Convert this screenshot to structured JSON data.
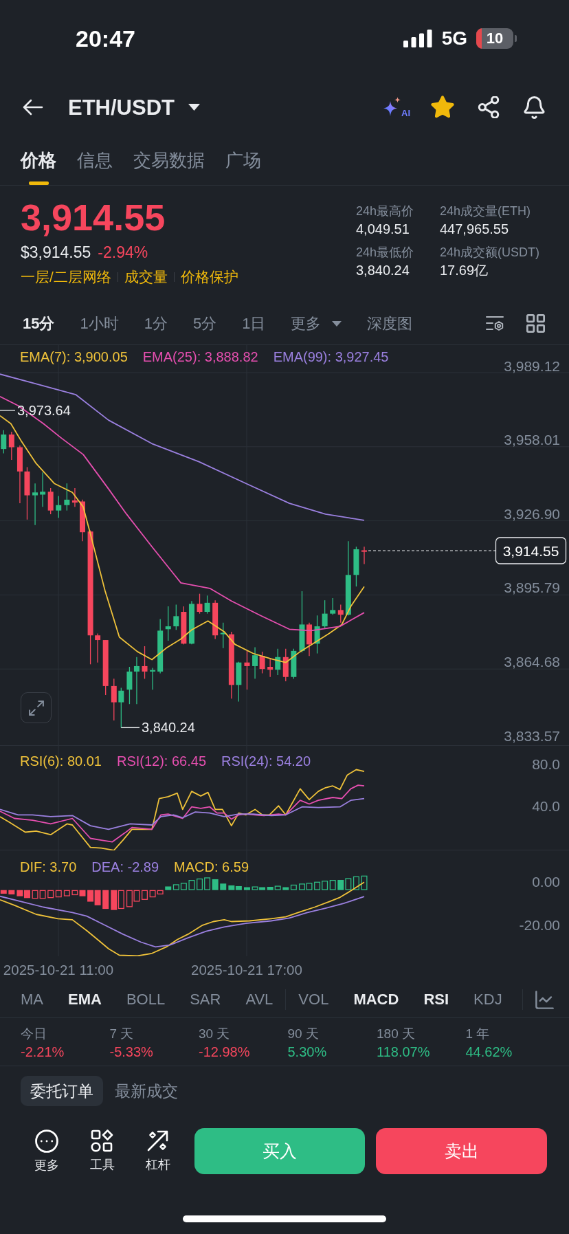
{
  "status_bar": {
    "time": "20:47",
    "network": "5G",
    "battery": "10"
  },
  "header": {
    "pair": "ETH/USDT",
    "ai_label": "AI",
    "favorite": true
  },
  "tabs": [
    {
      "label": "价格",
      "selected": true
    },
    {
      "label": "信息",
      "selected": false
    },
    {
      "label": "交易数据",
      "selected": false
    },
    {
      "label": "广场",
      "selected": false
    }
  ],
  "ticker": {
    "price": "3,914.55",
    "rising": false,
    "usd_price": "$3,914.55",
    "change": "-2.94%",
    "tags": [
      "一层/二层网络",
      "成交量",
      "价格保护"
    ],
    "stats": [
      {
        "label": "24h最高价",
        "value": "4,049.51"
      },
      {
        "label": "24h成交量(ETH)",
        "value": "447,965.55"
      },
      {
        "label": "24h最低价",
        "value": "3,840.24"
      },
      {
        "label": "24h成交额(USDT)",
        "value": "17.69亿"
      }
    ]
  },
  "intervals": [
    {
      "label": "15分",
      "selected": true,
      "kind": "option"
    },
    {
      "label": "1小时",
      "selected": false,
      "kind": "option"
    },
    {
      "label": "1分",
      "selected": false,
      "kind": "option"
    },
    {
      "label": "5分",
      "selected": false,
      "kind": "option"
    },
    {
      "label": "1日",
      "selected": false,
      "kind": "option"
    },
    {
      "label": "更多",
      "selected": false,
      "kind": "dropdown"
    },
    {
      "label": "深度图",
      "selected": false,
      "kind": "option"
    }
  ],
  "main_chart": {
    "legend": [
      {
        "label": "EMA(7): 3,900.05",
        "color": "#efc23a"
      },
      {
        "label": "EMA(25): 3,888.82",
        "color": "#e64fb0"
      },
      {
        "label": "EMA(99): 3,927.45",
        "color": "#9b80e0"
      }
    ],
    "y_labels": [
      "3,989.12",
      "3,958.01",
      "3,926.90",
      "3,895.79",
      "3,864.68",
      "3,833.57"
    ],
    "last_price": "3,914.55",
    "high_marker": "3,973.64",
    "low_marker": "3,840.24"
  },
  "rsi_chart": {
    "legend": [
      {
        "label": "RSI(6): 80.01",
        "color": "#efc23a"
      },
      {
        "label": "RSI(12): 66.45",
        "color": "#e64fb0"
      },
      {
        "label": "RSI(24): 54.20",
        "color": "#9b80e0"
      }
    ],
    "y_labels": [
      "80.0",
      "40.0"
    ]
  },
  "macd_chart": {
    "legend": [
      {
        "label": "DIF: 3.70",
        "color": "#efc23a"
      },
      {
        "label": "DEA: -2.89",
        "color": "#9b80e0"
      },
      {
        "label": "MACD: 6.59",
        "color": "#efc23a"
      }
    ],
    "y_labels": [
      "0.00",
      "-20.00"
    ]
  },
  "time_labels": [
    "2025-10-21 11:00",
    "2025-10-21 17:00"
  ],
  "indicators": {
    "main": [
      {
        "label": "MA",
        "selected": false
      },
      {
        "label": "EMA",
        "selected": true
      },
      {
        "label": "BOLL",
        "selected": false
      },
      {
        "label": "SAR",
        "selected": false
      },
      {
        "label": "AVL",
        "selected": false
      }
    ],
    "sub": [
      {
        "label": "VOL",
        "selected": false
      },
      {
        "label": "MACD",
        "selected": true
      },
      {
        "label": "RSI",
        "selected": true
      },
      {
        "label": "KDJ",
        "selected": false
      }
    ]
  },
  "performance": [
    {
      "period": "今日",
      "change": "-2.21%",
      "rising": false
    },
    {
      "period": "7 天",
      "change": "-5.33%",
      "rising": false
    },
    {
      "period": "30 天",
      "change": "-12.98%",
      "rising": false
    },
    {
      "period": "90 天",
      "change": "5.30%",
      "rising": true
    },
    {
      "period": "180 天",
      "change": "118.07%",
      "rising": true
    },
    {
      "period": "1 年",
      "change": "44.62%",
      "rising": true
    }
  ],
  "order_tabs": [
    {
      "label": "委托订单",
      "selected": true
    },
    {
      "label": "最新成交",
      "selected": false
    }
  ],
  "actions": {
    "tools": [
      {
        "label": "更多",
        "kind": "more"
      },
      {
        "label": "工具",
        "kind": "tools"
      },
      {
        "label": "杠杆",
        "kind": "leverage"
      }
    ],
    "buy": "买入",
    "sell": "卖出"
  }
}
